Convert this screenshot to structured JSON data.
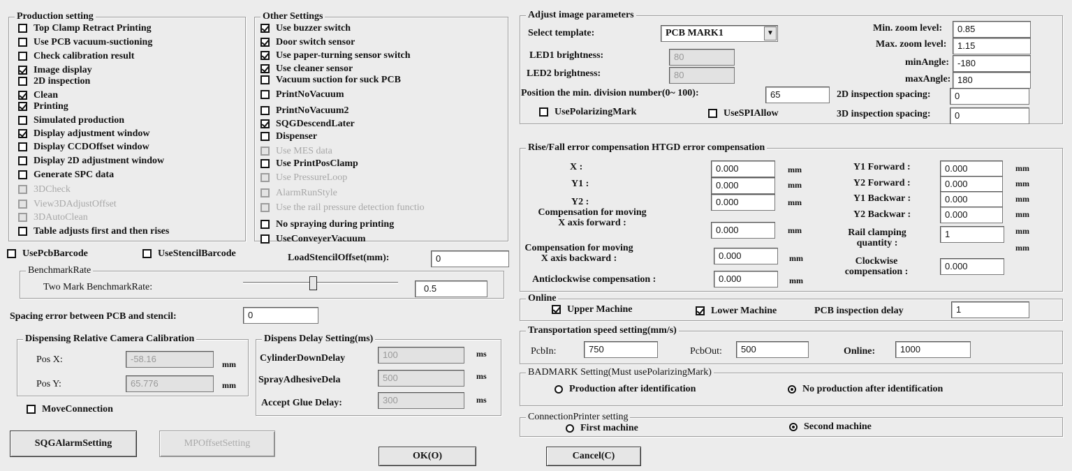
{
  "production": {
    "title": "Production setting",
    "items": [
      {
        "label": "Top Clamp Retract Printing",
        "checked": false,
        "enabled": true
      },
      {
        "label": "Use PCB vacuum-suctioning",
        "checked": false,
        "enabled": true
      },
      {
        "label": "Check calibration result",
        "checked": false,
        "enabled": true
      },
      {
        "label": "Image display",
        "checked": true,
        "enabled": true
      },
      {
        "label": "2D inspection",
        "checked": false,
        "enabled": true
      },
      {
        "label": "Clean",
        "checked": true,
        "enabled": true
      },
      {
        "label": "Printing",
        "checked": true,
        "enabled": true
      },
      {
        "label": "Simulated production",
        "checked": false,
        "enabled": true
      },
      {
        "label": "Display adjustment window",
        "checked": true,
        "enabled": true
      },
      {
        "label": "Display CCDOffset window",
        "checked": false,
        "enabled": true
      },
      {
        "label": "Display 2D adjustment window",
        "checked": false,
        "enabled": true
      },
      {
        "label": "Generate SPC data",
        "checked": false,
        "enabled": true
      },
      {
        "label": "3DCheck",
        "checked": false,
        "enabled": false
      },
      {
        "label": "View3DAdjustOffset",
        "checked": false,
        "enabled": false
      },
      {
        "label": "3DAutoClean",
        "checked": false,
        "enabled": false
      },
      {
        "label": "Table adjusts first and then rises",
        "checked": false,
        "enabled": true
      }
    ]
  },
  "other": {
    "title": "Other Settings",
    "items": [
      {
        "label": "Use buzzer switch",
        "checked": true,
        "enabled": true
      },
      {
        "label": "Door switch sensor",
        "checked": true,
        "enabled": true
      },
      {
        "label": "Use paper-turning sensor switch",
        "checked": true,
        "enabled": true
      },
      {
        "label": "Use cleaner sensor",
        "checked": true,
        "enabled": true
      },
      {
        "label": "Vacuum suction for suck PCB",
        "checked": false,
        "enabled": true
      },
      {
        "label": "PrintNoVacuum",
        "checked": false,
        "enabled": true
      },
      {
        "label": "PrintNoVacuum2",
        "checked": false,
        "enabled": true
      },
      {
        "label": "SQGDescendLater",
        "checked": true,
        "enabled": true
      },
      {
        "label": "Dispenser",
        "checked": false,
        "enabled": true
      },
      {
        "label": "Use MES data",
        "checked": false,
        "enabled": false
      },
      {
        "label": "Use PrintPosClamp",
        "checked": false,
        "enabled": true
      },
      {
        "label": "Use PressureLoop",
        "checked": false,
        "enabled": false
      },
      {
        "label": "AlarmRunStyle",
        "checked": false,
        "enabled": false
      },
      {
        "label": "Use the rail pressure detection functio",
        "checked": false,
        "enabled": false
      },
      {
        "label": "No spraying during printing",
        "checked": false,
        "enabled": true
      },
      {
        "label": "UseConveyerVacuum",
        "checked": false,
        "enabled": true
      }
    ]
  },
  "barcode": {
    "use_pcb_barcode": "UsePcbBarcode",
    "use_stencil_barcode": "UseStencilBarcode",
    "load_stencil_offset_label": "LoadStencilOffset(mm):",
    "load_stencil_offset_value": "0"
  },
  "benchmark": {
    "title": "BenchmarkRate",
    "label": "Two Mark BenchmarkRate:",
    "value": "0.5",
    "slider_fraction": 0.45
  },
  "spacing_error": {
    "label": "Spacing error between PCB and stencil:",
    "value": "0"
  },
  "dispensing": {
    "title": "Dispensing  Relative Camera Calibration",
    "pos_x_label": "Pos X:",
    "pos_x_value": "-58.16",
    "pos_y_label": "Pos Y:",
    "pos_y_value": "65.776",
    "unit": "mm"
  },
  "dispens_delay": {
    "title": "Dispens Delay Setting(ms)",
    "rows": [
      {
        "label": "CylinderDownDelay",
        "value": "100",
        "unit": "ms"
      },
      {
        "label": "SprayAdhesiveDela",
        "value": "500",
        "unit": "ms"
      },
      {
        "label": "Accept Glue Delay:",
        "value": "300",
        "unit": "ms"
      }
    ]
  },
  "move_connection": "MoveConnection",
  "buttons": {
    "sqg_alarm": "SQGAlarmSetting",
    "mp_offset": "MPOffsetSetting",
    "ok": "OK(O)",
    "cancel": "Cancel(C)"
  },
  "image_params": {
    "title": "Adjust image parameters",
    "select_template_label": "Select template:",
    "template_value": "PCB MARK1",
    "led1_label": "LED1 brightness:",
    "led1_value": "80",
    "led2_label": "LED2 brightness:",
    "led2_value": "80",
    "min_zoom_label": "Min. zoom level:",
    "min_zoom_value": "0.85",
    "max_zoom_label": "Max. zoom level:",
    "max_zoom_value": "1.15",
    "min_angle_label": "minAngle:",
    "min_angle_value": "-180",
    "max_angle_label": "maxAngle:",
    "max_angle_value": "180",
    "division_label": "Position the min. division number(0~ 100):",
    "division_value": "65",
    "insp2d_label": "2D inspection spacing:",
    "insp2d_value": "0",
    "insp3d_label": "3D inspection spacing:",
    "insp3d_value": "0",
    "use_polarizing": "UsePolarizingMark",
    "use_spi": "UseSPIAllow"
  },
  "compensation": {
    "title": "Rise/Fall error compensation  HTGD error compensation",
    "x_label": "X  :",
    "x_value": "0.000",
    "y1_label": "Y1  :",
    "y1_value": "0.000",
    "y2_label": "Y2  :",
    "y2_value": "0.000",
    "fwd_label": "Compensation for moving X axis forward :",
    "fwd_value": "0.000",
    "bwd_label": "Compensation for moving X axis backward :",
    "bwd_value": "0.000",
    "anti_label": "Anticlockwise compensation :",
    "anti_value": "0.000",
    "y1f_label": "Y1 Forward :",
    "y1f_value": "0.000",
    "y2f_label": "Y2 Forward :",
    "y2f_value": "0.000",
    "y1b_label": "Y1 Backwar :",
    "y1b_value": "0.000",
    "y2b_label": "Y2 Backwar :",
    "y2b_value": "0.000",
    "rail_label": "Rail clamping quantity :",
    "rail_value": "1",
    "cw_label": "Clockwise compensation :",
    "cw_value": "0.000",
    "unit": "mm"
  },
  "online": {
    "title": "Online",
    "upper": "Upper Machine",
    "lower": "Lower Machine",
    "delay_label": "PCB inspection delay",
    "delay_value": "1"
  },
  "transport": {
    "title": "Transportation speed setting(mm/s)",
    "pcbin_label": "PcbIn:",
    "pcbin_value": "750",
    "pcbout_label": "PcbOut:",
    "pcbout_value": "500",
    "online_label": "Online:",
    "online_value": "1000"
  },
  "badmark": {
    "title": "BADMARK Setting(Must usePolarizingMark)",
    "opt1": "Production after identification",
    "opt2": "No production after identification",
    "selected": 2
  },
  "connection": {
    "title": "ConnectionPrinter  setting",
    "opt1": "First machine",
    "opt2": "Second machine",
    "selected": 2
  }
}
